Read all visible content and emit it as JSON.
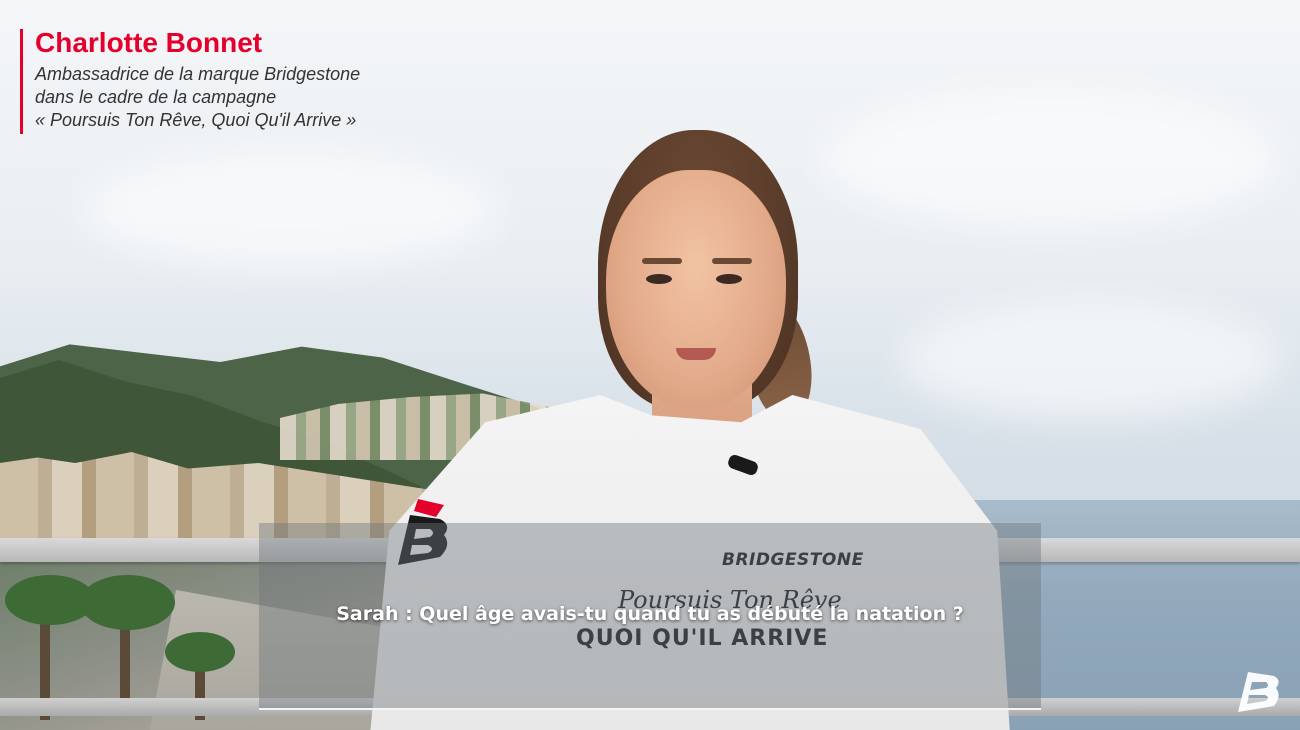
{
  "caption": {
    "name": "Charlotte Bonnet",
    "line1": "Ambassadrice de la marque Bridgestone",
    "line2": "dans le cadre de la campagne",
    "line3": "« Poursuis Ton Rêve, Quoi Qu'il Arrive »"
  },
  "subtitle": {
    "text": "Sarah : Quel âge avais-tu quand tu as débuté la natation ?"
  },
  "shirt": {
    "brand": "BRIDGESTONE",
    "line1": "Poursuis Ton Rêve",
    "line2": "QUOI QU'IL ARRIVE"
  },
  "colors": {
    "accent_red": "#e4002b",
    "caption_text": "#333333",
    "subtitle_panel": "rgba(110,116,122,0.42)"
  },
  "icons": {
    "corner_logo": "bridgestone-b-logo-icon",
    "sleeve_logo": "bridgestone-b-logo-icon"
  }
}
